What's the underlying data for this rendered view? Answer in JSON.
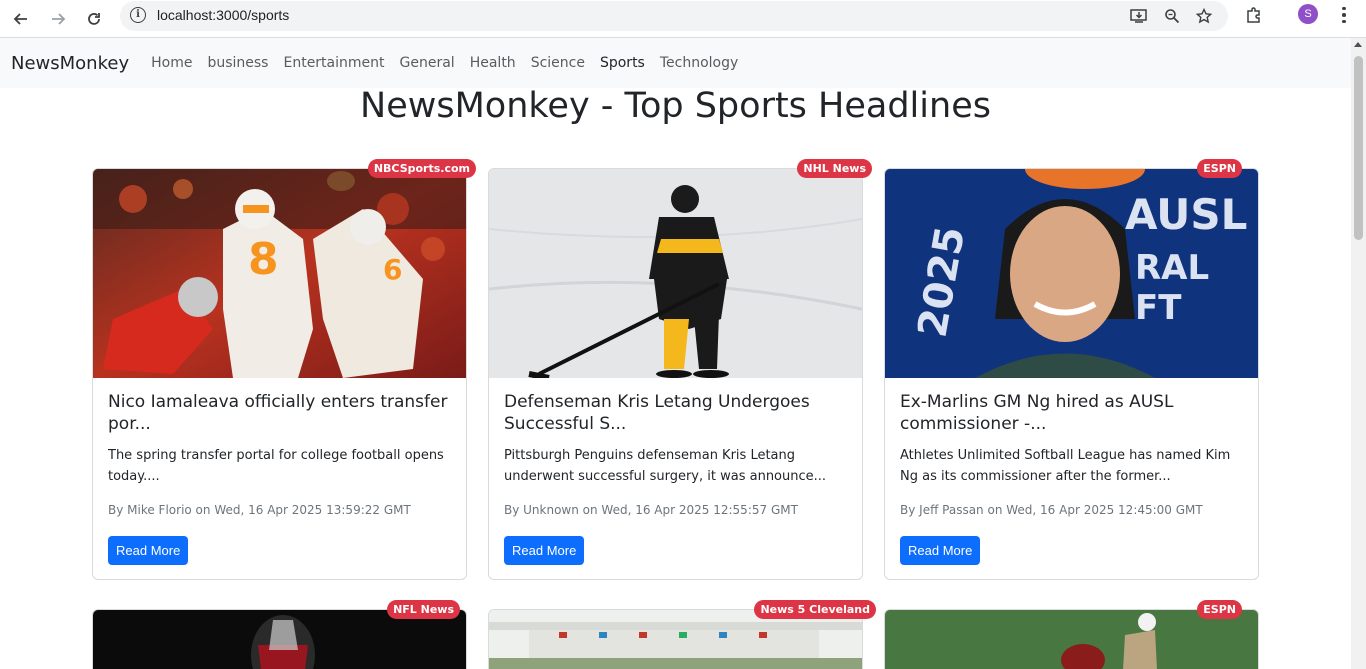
{
  "browser": {
    "url": "localhost:3000/sports",
    "avatar_letter": "S"
  },
  "navbar": {
    "brand": "NewsMonkey",
    "links": [
      "Home",
      "business",
      "Entertainment",
      "General",
      "Health",
      "Science",
      "Sports",
      "Technology"
    ],
    "active": "Sports"
  },
  "page": {
    "title": "NewsMonkey - Top Sports Headlines"
  },
  "articles": [
    {
      "source": "NBCSports.com",
      "title": "Nico Iamaleava officially enters transfer por...",
      "description": "The spring transfer portal for college football opens today....",
      "meta": "By Mike Florio on Wed, 16 Apr 2025 13:59:22 GMT",
      "button": "Read More"
    },
    {
      "source": "NHL News",
      "title": "Defenseman Kris Letang Undergoes Successful S...",
      "description": "Pittsburgh Penguins defenseman Kris Letang underwent successful surgery, it was announce...",
      "meta": "By Unknown on Wed, 16 Apr 2025 12:55:57 GMT",
      "button": "Read More"
    },
    {
      "source": "ESPN",
      "title": "Ex-Marlins GM Ng hired as AUSL commissioner -...",
      "description": "Athletes Unlimited Softball League has named Kim Ng as its commissioner after the former...",
      "meta": "By Jeff Passan on Wed, 16 Apr 2025 12:45:00 GMT",
      "button": "Read More"
    },
    {
      "source": "NFL News"
    },
    {
      "source": "News 5 Cleveland"
    },
    {
      "source": "ESPN"
    }
  ],
  "colors": {
    "badge": "#dc3545",
    "button": "#0d6efd",
    "navbar_bg": "#f8f9fa"
  }
}
